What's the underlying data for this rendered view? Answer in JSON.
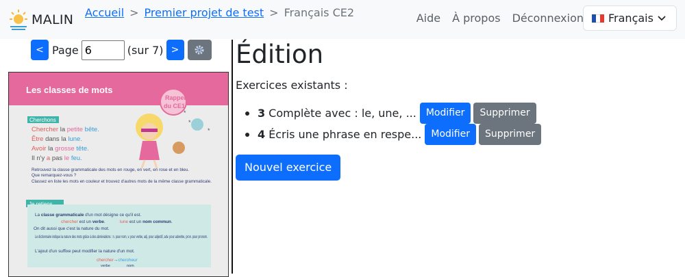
{
  "brand": {
    "name": "MALIN"
  },
  "breadcrumb": {
    "home": "Accueil",
    "project": "Premier projet de test",
    "current": "Français CE2",
    "separator": ">"
  },
  "nav": {
    "help": "Aide",
    "about": "À propos",
    "logout": "Déconnexion"
  },
  "language": {
    "selected": "Français",
    "flag": "france-flag-icon"
  },
  "pager": {
    "prev": "<",
    "next": ">",
    "label": "Page",
    "value": "6",
    "total": "(sur 7)",
    "settings_icon": "gear-icon"
  },
  "page_preview": {
    "heading": "Les classes de mots",
    "badge_line1": "Rappel",
    "badge_line2": "du CE1",
    "section1": "Cherchons",
    "lines": [
      [
        "Chercher",
        " la ",
        "petite",
        " bête."
      ],
      [
        "Être",
        " dans ",
        "la",
        " ",
        "lune."
      ],
      [
        "Avoir",
        " la ",
        "grosse",
        " ",
        "tête."
      ],
      [
        "Il n'y ",
        "a",
        " pas ",
        "le",
        " ",
        "feu."
      ]
    ],
    "bullet1": "Retrouvez la classe grammaticale des mots en rouge, en vert, en rose et en bleu.",
    "bullet1b": "Que remarquez-vous ?",
    "bullet2": "Classez en liste les mots en couleur et trouvez d'autres mots de la même classe grammaticale.",
    "section2": "Je retiens",
    "r1a": "La ",
    "r1b": "classe grammaticale",
    "r1c": " d'un mot désigne ce qu'il est.",
    "r2a": "chercher",
    "r2b": " est un ",
    "r2c": "verbe",
    "r2d": ".",
    "r2e": "lune",
    "r2f": " est un ",
    "r2g": "nom commun",
    "r2h": ".",
    "r3": "On dit aussi que c'est la nature du mot.",
    "r4": "Le dictionnaire indique la nature des mots grâce à des abréviations : n. pour nom, v. pour verbe, adj. pour adjectif, adv. pour adverbe, pron. pour pronom.",
    "r5": "L'ajout d'un suffixe peut modifier la nature d'un mot.",
    "r6a": "chercher",
    "r6arrow": "→",
    "r6b": "chercheur",
    "r6c": "verbe",
    "r6d": "nom"
  },
  "main": {
    "title": "Édition",
    "subtitle": "Exercices existants :",
    "exercises": [
      {
        "num": "3",
        "text": "Complète avec : le, une, ...",
        "edit": "Modifier",
        "delete": "Supprimer"
      },
      {
        "num": "4",
        "text": "Écris une phrase en respe...",
        "edit": "Modifier",
        "delete": "Supprimer"
      }
    ],
    "new_button": "Nouvel exercice"
  },
  "colors": {
    "primary": "#0d6efd",
    "secondary": "#6c757d",
    "navbar": "#f8f9fa",
    "page_header": "#e8679a",
    "teal": "#3fb4a8"
  }
}
